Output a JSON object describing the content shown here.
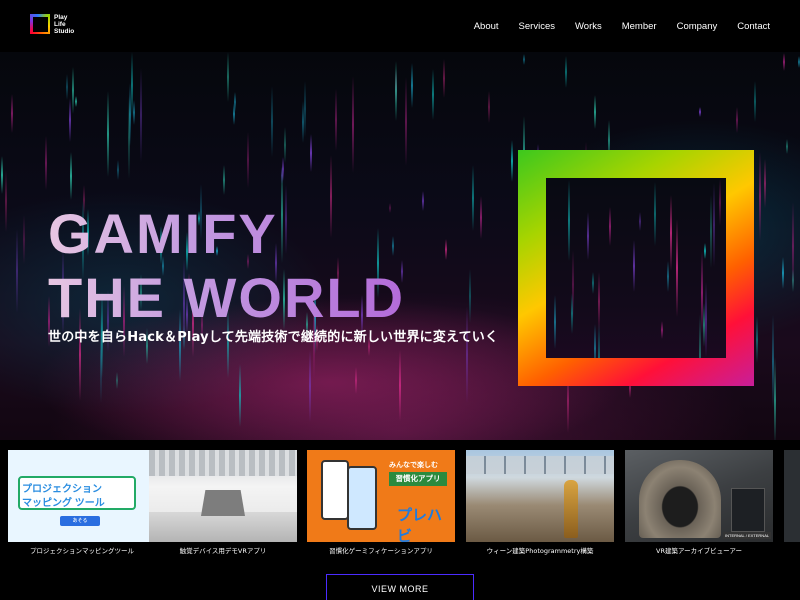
{
  "header": {
    "logo": {
      "line1": "Play",
      "line2": "Life",
      "line3": "Studio"
    },
    "nav": [
      {
        "label": "About"
      },
      {
        "label": "Services"
      },
      {
        "label": "Works"
      },
      {
        "label": "Member"
      },
      {
        "label": "Company"
      },
      {
        "label": "Contact"
      }
    ]
  },
  "hero": {
    "title_line1": "GAMIFY",
    "title_line2": "THE WORLD",
    "subtitle": "世の中を自らHack＆Playして先端技術で継続的に新しい世界に変えていく"
  },
  "works": [
    {
      "caption": "プロジェクションマッピングツール",
      "thumb_text1": "プロジェクション",
      "thumb_text2": "マッピング ツール",
      "thumb_button": "あそる"
    },
    {
      "caption": "触覚デバイス用デモVRアプリ"
    },
    {
      "caption": "習慣化ゲーミフィケーションアプリ",
      "thumb_text1": "みんなで楽しむ",
      "thumb_text2": "習慣化アプリ",
      "thumb_logo": "プレハビ"
    },
    {
      "caption": "ウィーン建築Photogrammetry構築"
    },
    {
      "caption": "VR建築アーカイブビューアー",
      "thumb_tag": "INTERNAL / EXTERNAL"
    }
  ],
  "view_more": "VIEW MORE",
  "colors": {
    "frame_gradient": [
      "#3cc81e",
      "#a7d400",
      "#ffc800",
      "#ff6000",
      "#ff1038",
      "#c81e9a"
    ],
    "title_gradient": [
      "#e7c6e2",
      "#c39be0",
      "#b36bd9"
    ],
    "button_border": "#4b2cff"
  }
}
